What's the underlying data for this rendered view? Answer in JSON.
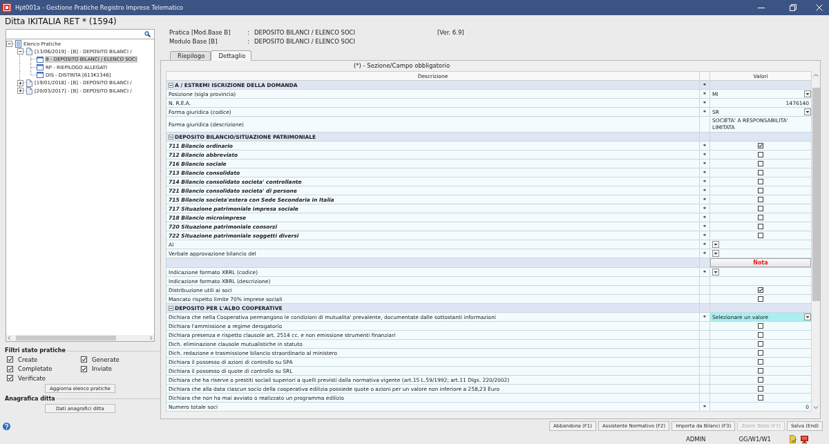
{
  "window": {
    "title": "Hpt001a - Gestione Pratiche Registro Imprese Telematico"
  },
  "company_title": "Ditta IKITALIA RET * (1594)",
  "sidebar": {
    "tree": [
      {
        "label": "Elenco Pratiche",
        "kind": "archive",
        "expanded": true,
        "selected": false,
        "children": [
          {
            "label": "[13/06/2019] - [B] - DEPOSITO BILANCI /",
            "kind": "practice",
            "expanded": true,
            "selected": false,
            "children": [
              {
                "label": "B - DEPOSITO BILANCI / ELENCO SOCI",
                "kind": "module",
                "selected": true
              },
              {
                "label": "RP - RIEPILOGO ALLEGATI",
                "kind": "module",
                "selected": false
              },
              {
                "label": "DIS - DISTINTA [613K1346]",
                "kind": "module",
                "selected": false
              }
            ]
          },
          {
            "label": "[19/01/2018] - [B] - DEPOSITO BILANCI /",
            "kind": "practice",
            "expanded": false,
            "selected": false
          },
          {
            "label": "[20/03/2017] - [B] - DEPOSITO BILANCI /",
            "kind": "practice",
            "expanded": false,
            "selected": false
          }
        ]
      }
    ],
    "filters": {
      "title": "Filtri stato pratiche",
      "options": [
        {
          "label": "Create",
          "checked": true
        },
        {
          "label": "Generate",
          "checked": true
        },
        {
          "label": "Completate",
          "checked": true
        },
        {
          "label": "Inviate",
          "checked": true
        },
        {
          "label": "Verificate",
          "checked": true
        }
      ],
      "button": "Aggiorna elenco pratiche"
    },
    "company": {
      "title": "Anagrafica ditta",
      "button": "Dati anagrafici ditta"
    }
  },
  "practice": {
    "rows": [
      {
        "label": "Pratica [Mod.Base B]",
        "separator": ":",
        "value": "DEPOSITO BILANCI / ELENCO SOCI",
        "version": "[Ver. 6.9]"
      },
      {
        "label": "Modulo Base [B]",
        "separator": ":",
        "value": "DEPOSITO BILANCI / ELENCO SOCI"
      }
    ]
  },
  "tabs": [
    {
      "label": "Riepilogo",
      "selected": false
    },
    {
      "label": "Dettaglio",
      "selected": true
    }
  ],
  "form": {
    "legend": "(*) - Sezione/Campo obbligatorio",
    "columns": [
      "Descrizione",
      "Valori"
    ],
    "rows": [
      {
        "kind": "section",
        "label": "A / ESTREMI ISCRIZIONE DELLA DOMANDA",
        "required_mark": "*",
        "expanded": true
      },
      {
        "kind": "field",
        "label": "Posizione (sigla provincia)",
        "required_mark": "*",
        "emphasis": false,
        "value": {
          "kind": "select",
          "text": "MI",
          "focused": false
        }
      },
      {
        "kind": "field",
        "label": "N. R.E.A.",
        "required_mark": "*",
        "emphasis": false,
        "value": {
          "kind": "number",
          "text": "1476140"
        }
      },
      {
        "kind": "field",
        "label": "Forma giuridica (codice)",
        "required_mark": "*",
        "emphasis": false,
        "value": {
          "kind": "select",
          "text": "SR",
          "focused": false
        }
      },
      {
        "kind": "field",
        "label": "Forma giuridica (descrizione)",
        "emphasis": false,
        "value": {
          "kind": "text",
          "text": "SOCIETA' A RESPONSABILITA' LIMITATA"
        }
      },
      {
        "kind": "section",
        "label": "DEPOSITO BILANCIO/SITUAZIONE PATRIMONIALE",
        "expanded": true
      },
      {
        "kind": "field",
        "label": "711 Bilancio ordinario",
        "required_mark": "*",
        "emphasis": true,
        "value": {
          "kind": "checkbox",
          "checked": true
        }
      },
      {
        "kind": "field",
        "label": "712 Bilancio abbreviato",
        "required_mark": "*",
        "emphasis": true,
        "value": {
          "kind": "checkbox",
          "checked": false
        }
      },
      {
        "kind": "field",
        "label": "716 Bilancio sociale",
        "required_mark": "*",
        "emphasis": true,
        "value": {
          "kind": "checkbox",
          "checked": false
        }
      },
      {
        "kind": "field",
        "label": "713 Bilancio consolidato",
        "required_mark": "*",
        "emphasis": true,
        "value": {
          "kind": "checkbox",
          "checked": false
        }
      },
      {
        "kind": "field",
        "label": "714 Bilancio consolidato societa' controllante",
        "required_mark": "*",
        "emphasis": true,
        "value": {
          "kind": "checkbox",
          "checked": false
        }
      },
      {
        "kind": "field",
        "label": "721 Bilancio consolidato societa' di persone",
        "required_mark": "*",
        "emphasis": true,
        "value": {
          "kind": "checkbox",
          "checked": false
        }
      },
      {
        "kind": "field",
        "label": "715 Bilancio societa'estera con Sede Secondaria in Italia",
        "required_mark": "*",
        "emphasis": true,
        "value": {
          "kind": "checkbox",
          "checked": false
        }
      },
      {
        "kind": "field",
        "label": "717 Situazione patrimoniale impresa sociale",
        "required_mark": "*",
        "emphasis": true,
        "value": {
          "kind": "checkbox",
          "checked": false
        }
      },
      {
        "kind": "field",
        "label": "718 Bilancio microimprese",
        "required_mark": "*",
        "emphasis": true,
        "value": {
          "kind": "checkbox",
          "checked": false
        }
      },
      {
        "kind": "field",
        "label": "720 Situazione patrimoniale consorzi",
        "required_mark": "*",
        "emphasis": true,
        "value": {
          "kind": "checkbox",
          "checked": false
        }
      },
      {
        "kind": "field",
        "label": "722 Situazione patrimoniale soggetti diversi",
        "required_mark": "*",
        "emphasis": true,
        "value": {
          "kind": "checkbox",
          "checked": false
        }
      },
      {
        "kind": "field",
        "label": "Al",
        "required_mark": "*",
        "emphasis": false,
        "value": {
          "kind": "select",
          "focused": false
        }
      },
      {
        "kind": "field",
        "label": "Verbale approvazione bilancio del",
        "required_mark": "*",
        "emphasis": false,
        "value": {
          "kind": "select",
          "focused": false
        }
      },
      {
        "kind": "note",
        "value_header": "Nota"
      },
      {
        "kind": "field",
        "label": "Indicazione formato XBRL (codice)",
        "required_mark": "*",
        "emphasis": false,
        "value": {
          "kind": "select",
          "focused": false
        }
      },
      {
        "kind": "field",
        "label": "Indicazione formato XBRL (descrizione)",
        "emphasis": false
      },
      {
        "kind": "field",
        "label": "Distribuzione utili ai soci",
        "emphasis": false,
        "value": {
          "kind": "checkbox",
          "checked": true
        }
      },
      {
        "kind": "field",
        "label": "Mancato rispetto limite 70% imprese sociali",
        "emphasis": false,
        "value": {
          "kind": "checkbox",
          "checked": false
        }
      },
      {
        "kind": "section",
        "label": "DEPOSITO PER L'ALBO COOPERATIVE",
        "expanded": true
      },
      {
        "kind": "field",
        "label": "Dichiara che nella Cooperativa permangono le condizioni di mutualita' prevalente, documentate dalle sottostanti informazioni",
        "required_mark": "*",
        "emphasis": false,
        "value": {
          "kind": "select",
          "text": "Selezionare un valore",
          "focused": true
        }
      },
      {
        "kind": "field",
        "label": "Dichiara l'ammissione a regime derogatorio",
        "emphasis": false,
        "value": {
          "kind": "checkbox",
          "checked": false
        }
      },
      {
        "kind": "field",
        "label": "Dichiara presenza e rispetto clausole art. 2514 cc. e non emissione strumenti finanziari",
        "emphasis": false,
        "value": {
          "kind": "checkbox",
          "checked": false
        }
      },
      {
        "kind": "field",
        "label": "Dich. eliminazione clausole mutualistiche in statuto",
        "emphasis": false,
        "value": {
          "kind": "checkbox",
          "checked": false
        }
      },
      {
        "kind": "field",
        "label": "Dich. redazione e trasmissione bilancio straordinario al ministero",
        "emphasis": false,
        "value": {
          "kind": "checkbox",
          "checked": false
        }
      },
      {
        "kind": "field",
        "label": "Dichiara il possesso di azioni di controllo su SPA",
        "emphasis": false,
        "value": {
          "kind": "checkbox",
          "checked": false
        }
      },
      {
        "kind": "field",
        "label": "Dichiara il possesso di quote di controllo su SRL",
        "emphasis": false,
        "value": {
          "kind": "checkbox",
          "checked": false
        }
      },
      {
        "kind": "field",
        "label": "Dichiara che ha riserve o prestiti sociali superiori a quelli previsti dalla normativa vigente (art.15 L.59/1992; art.11 Dlgs. 220/2002)",
        "emphasis": false,
        "value": {
          "kind": "checkbox",
          "checked": false
        }
      },
      {
        "kind": "field",
        "label": "Dichiara che alla data ciascun socio della cooperativa edilizia possiede quote o azioni per un valore non inferiore a 258,23 Euro",
        "emphasis": false,
        "value": {
          "kind": "checkbox",
          "checked": false
        }
      },
      {
        "kind": "field",
        "label": "Dichiara che non ha mai avviato o realizzato un programma edilizio",
        "emphasis": false,
        "value": {
          "kind": "checkbox",
          "checked": false
        }
      },
      {
        "kind": "field",
        "label": "Numero totale soci",
        "required_mark": "*",
        "emphasis": false,
        "value": {
          "kind": "number",
          "text": "0"
        }
      }
    ]
  },
  "buttons": [
    {
      "label": "Abbandona (F1)",
      "disabled": false
    },
    {
      "label": "Assistente Normativo (F2)",
      "disabled": false
    },
    {
      "label": "Importa da Bilanci (F3)",
      "disabled": false
    },
    {
      "label": "Zoom Testo (F7)",
      "disabled": true
    },
    {
      "label": "Salva (End)",
      "disabled": false
    }
  ],
  "status_bar": {
    "user": "ADMIN",
    "workstation": "GG/W1/W1"
  }
}
